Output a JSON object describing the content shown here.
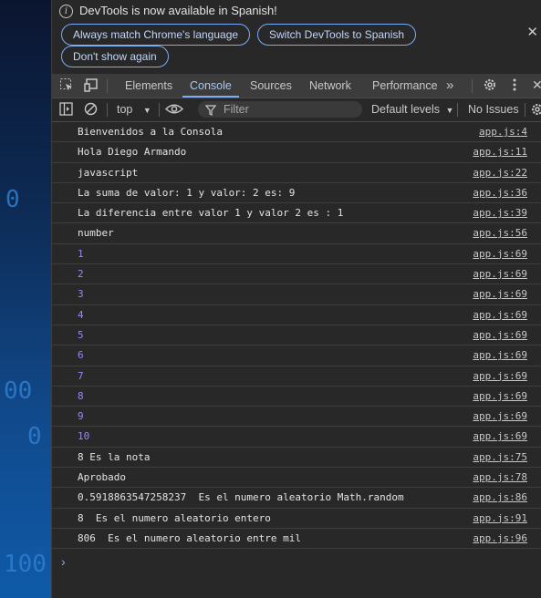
{
  "page_background": {
    "digits": [
      "0",
      "00",
      "0",
      "100"
    ]
  },
  "infobar": {
    "message": "DevTools is now available in Spanish!",
    "buttons": {
      "match": "Always match Chrome's language",
      "switch": "Switch DevTools to Spanish",
      "dont_show": "Don't show again"
    },
    "close": "✕"
  },
  "tabs": {
    "items": [
      "Elements",
      "Console",
      "Sources",
      "Network",
      "Performance"
    ],
    "active": "Console",
    "more": "»"
  },
  "console_toolbar": {
    "context": "top",
    "filter_placeholder": "Filter",
    "levels": "Default levels",
    "issues": "No Issues"
  },
  "log": [
    {
      "text": "Bienvenidos a la Consola",
      "source": "app.js:4",
      "kind": "text"
    },
    {
      "text": "Hola Diego Armando",
      "source": "app.js:11",
      "kind": "text"
    },
    {
      "text": "javascript",
      "source": "app.js:22",
      "kind": "text"
    },
    {
      "text": "La suma de valor: 1 y valor: 2 es: 9",
      "source": "app.js:36",
      "kind": "text"
    },
    {
      "text": "La diferencia entre valor 1 y valor 2 es : 1",
      "source": "app.js:39",
      "kind": "text"
    },
    {
      "text": "number",
      "source": "app.js:56",
      "kind": "text"
    },
    {
      "text": "1",
      "source": "app.js:69",
      "kind": "num"
    },
    {
      "text": "2",
      "source": "app.js:69",
      "kind": "num"
    },
    {
      "text": "3",
      "source": "app.js:69",
      "kind": "num"
    },
    {
      "text": "4",
      "source": "app.js:69",
      "kind": "num"
    },
    {
      "text": "5",
      "source": "app.js:69",
      "kind": "num"
    },
    {
      "text": "6",
      "source": "app.js:69",
      "kind": "num"
    },
    {
      "text": "7",
      "source": "app.js:69",
      "kind": "num"
    },
    {
      "text": "8",
      "source": "app.js:69",
      "kind": "num"
    },
    {
      "text": "9",
      "source": "app.js:69",
      "kind": "num"
    },
    {
      "text": "10",
      "source": "app.js:69",
      "kind": "num"
    },
    {
      "text": "8 Es la nota",
      "source": "app.js:75",
      "kind": "text"
    },
    {
      "text": "Aprobado",
      "source": "app.js:78",
      "kind": "text"
    },
    {
      "text": "0.5918863547258237  Es el numero aleatorio Math.random",
      "source": "app.js:86",
      "kind": "text"
    },
    {
      "text": "8  Es el numero aleatorio entero",
      "source": "app.js:91",
      "kind": "text"
    },
    {
      "text": "806  Es el numero aleatorio entre mil",
      "source": "app.js:96",
      "kind": "text"
    }
  ],
  "prompt": "›"
}
